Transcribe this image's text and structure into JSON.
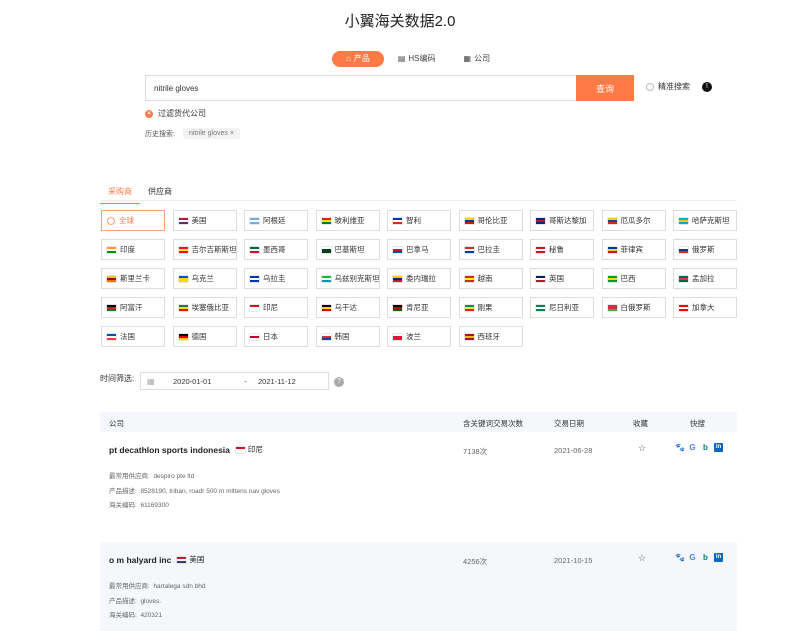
{
  "app_title": "小翼海关数据2.0",
  "tabs": [
    {
      "label": "产品",
      "icon": "box-icon"
    },
    {
      "label": "HS编码",
      "icon": "document-icon"
    },
    {
      "label": "公司",
      "icon": "building-icon"
    }
  ],
  "search": {
    "value": "nitrile gloves",
    "button": "查询",
    "precise_label": "精准搜索"
  },
  "filter_label": "过滤货代公司",
  "history": {
    "label": "历史搜索:",
    "items": [
      "nitrile gloves"
    ]
  },
  "segments": [
    "采购商",
    "供应商"
  ],
  "countries": [
    {
      "name": "全球",
      "c": [
        "#bbb"
      ]
    },
    {
      "name": "美国",
      "c": [
        "#b22234",
        "#fff",
        "#3c3b6e"
      ]
    },
    {
      "name": "阿根廷",
      "c": [
        "#74acdf",
        "#fff",
        "#74acdf"
      ]
    },
    {
      "name": "玻利维亚",
      "c": [
        "#d52b1e",
        "#f9e300",
        "#007934"
      ]
    },
    {
      "name": "智利",
      "c": [
        "#0039a6",
        "#fff",
        "#d52b1e"
      ]
    },
    {
      "name": "哥伦比亚",
      "c": [
        "#fcd116",
        "#003893",
        "#ce1126"
      ]
    },
    {
      "name": "哥斯达黎加",
      "c": [
        "#002b7f",
        "#ce1126",
        "#002b7f"
      ]
    },
    {
      "name": "厄瓜多尔",
      "c": [
        "#ffd100",
        "#034ea2",
        "#ed1c24"
      ]
    },
    {
      "name": "哈萨克斯坦",
      "c": [
        "#00afca",
        "#fec50c",
        "#00afca"
      ]
    },
    {
      "name": "印度",
      "c": [
        "#ff9933",
        "#fff",
        "#138808"
      ]
    },
    {
      "name": "吉尔吉斯斯坦",
      "c": [
        "#e8112d",
        "#ffef00",
        "#e8112d"
      ]
    },
    {
      "name": "墨西哥",
      "c": [
        "#006847",
        "#fff",
        "#ce1126"
      ]
    },
    {
      "name": "巴基斯坦",
      "c": [
        "#fff",
        "#01411c",
        "#01411c"
      ]
    },
    {
      "name": "巴拿马",
      "c": [
        "#fff",
        "#d21034",
        "#005293"
      ]
    },
    {
      "name": "巴拉圭",
      "c": [
        "#d52b1e",
        "#fff",
        "#0038a8"
      ]
    },
    {
      "name": "秘鲁",
      "c": [
        "#d91023",
        "#fff",
        "#d91023"
      ]
    },
    {
      "name": "菲律宾",
      "c": [
        "#0038a8",
        "#fcd116",
        "#ce1126"
      ]
    },
    {
      "name": "俄罗斯",
      "c": [
        "#fff",
        "#0039a6",
        "#d52b1e"
      ]
    },
    {
      "name": "斯里兰卡",
      "c": [
        "#ffbe29",
        "#8d153a",
        "#eb7400"
      ]
    },
    {
      "name": "乌克兰",
      "c": [
        "#0057b7",
        "#ffd700",
        "#ffd700"
      ]
    },
    {
      "name": "乌拉圭",
      "c": [
        "#0038a8",
        "#fff",
        "#0038a8"
      ]
    },
    {
      "name": "乌兹别克斯坦",
      "c": [
        "#1eb53a",
        "#fff",
        "#0099b5"
      ]
    },
    {
      "name": "委内瑞拉",
      "c": [
        "#ffcc00",
        "#00247d",
        "#cf142b"
      ]
    },
    {
      "name": "越南",
      "c": [
        "#da251d",
        "#ffff00",
        "#da251d"
      ]
    },
    {
      "name": "英国",
      "c": [
        "#012169",
        "#fff",
        "#c8102e"
      ]
    },
    {
      "name": "巴西",
      "c": [
        "#009c3b",
        "#ffdf00",
        "#009c3b"
      ]
    },
    {
      "name": "孟加拉",
      "c": [
        "#006a4e",
        "#f42a41",
        "#006a4e"
      ]
    },
    {
      "name": "阿富汗",
      "c": [
        "#000",
        "#d32011",
        "#007a36"
      ]
    },
    {
      "name": "埃塞俄比亚",
      "c": [
        "#078930",
        "#fcdd09",
        "#da121a"
      ]
    },
    {
      "name": "印尼",
      "c": [
        "#ce1126",
        "#fff",
        "#fff"
      ]
    },
    {
      "name": "乌干达",
      "c": [
        "#000",
        "#fcdc04",
        "#d90000"
      ]
    },
    {
      "name": "肯尼亚",
      "c": [
        "#000",
        "#bb0000",
        "#006600"
      ]
    },
    {
      "name": "刚果",
      "c": [
        "#009543",
        "#fbde4a",
        "#dc241f"
      ]
    },
    {
      "name": "尼日利亚",
      "c": [
        "#008751",
        "#fff",
        "#008751"
      ]
    },
    {
      "name": "白俄罗斯",
      "c": [
        "#c8313e",
        "#c8313e",
        "#4aa657"
      ]
    },
    {
      "name": "加拿大",
      "c": [
        "#ff0000",
        "#fff",
        "#ff0000"
      ]
    },
    {
      "name": "法国",
      "c": [
        "#0055a4",
        "#fff",
        "#ef4135"
      ]
    },
    {
      "name": "德国",
      "c": [
        "#000",
        "#dd0000",
        "#ffce00"
      ]
    },
    {
      "name": "日本",
      "c": [
        "#fff",
        "#bc002d",
        "#fff"
      ]
    },
    {
      "name": "韩国",
      "c": [
        "#fff",
        "#cd2e3a",
        "#0047a0"
      ]
    },
    {
      "name": "波兰",
      "c": [
        "#fff",
        "#dc143c",
        "#dc143c"
      ]
    },
    {
      "name": "西班牙",
      "c": [
        "#aa151b",
        "#f1bf00",
        "#aa151b"
      ]
    }
  ],
  "time_filter": {
    "label": "时间筛选:",
    "start": "2020-01-01",
    "sep": "-",
    "end": "2021-11-12"
  },
  "table": {
    "headers": {
      "company": "公司",
      "count": "含关键词交易次数",
      "date": "交易日期",
      "fav": "收藏",
      "quick": "快搜"
    },
    "labels": {
      "supplier": "最常用供应商:",
      "product": "产品描述:",
      "hs": "海关编码:"
    },
    "rows": [
      {
        "company": "pt decathlon sports indonesia",
        "country": "印尼",
        "count": "7138次",
        "date": "2021-06-28",
        "supplier": "despiro pte ltd",
        "product": "8528190, triban, roadr 500 m mittens nav gloves",
        "hs": "61169300"
      },
      {
        "company": "o m halyard inc",
        "country": "美国",
        "count": "4256次",
        "date": "2021-10-15",
        "supplier": "hartalega sdn bhd",
        "product": "gloves.",
        "hs": "420321"
      }
    ]
  },
  "quick_links": [
    {
      "icon": "baidu-icon",
      "glyph": "🐾",
      "color": "#2932e1"
    },
    {
      "icon": "google-icon",
      "glyph": "G",
      "color": "#4285f4"
    },
    {
      "icon": "bing-icon",
      "glyph": "b",
      "color": "#008373"
    },
    {
      "icon": "linkedin-icon",
      "glyph": "in",
      "color": "#0a66c2"
    }
  ],
  "accent_color": "#ff7a45"
}
